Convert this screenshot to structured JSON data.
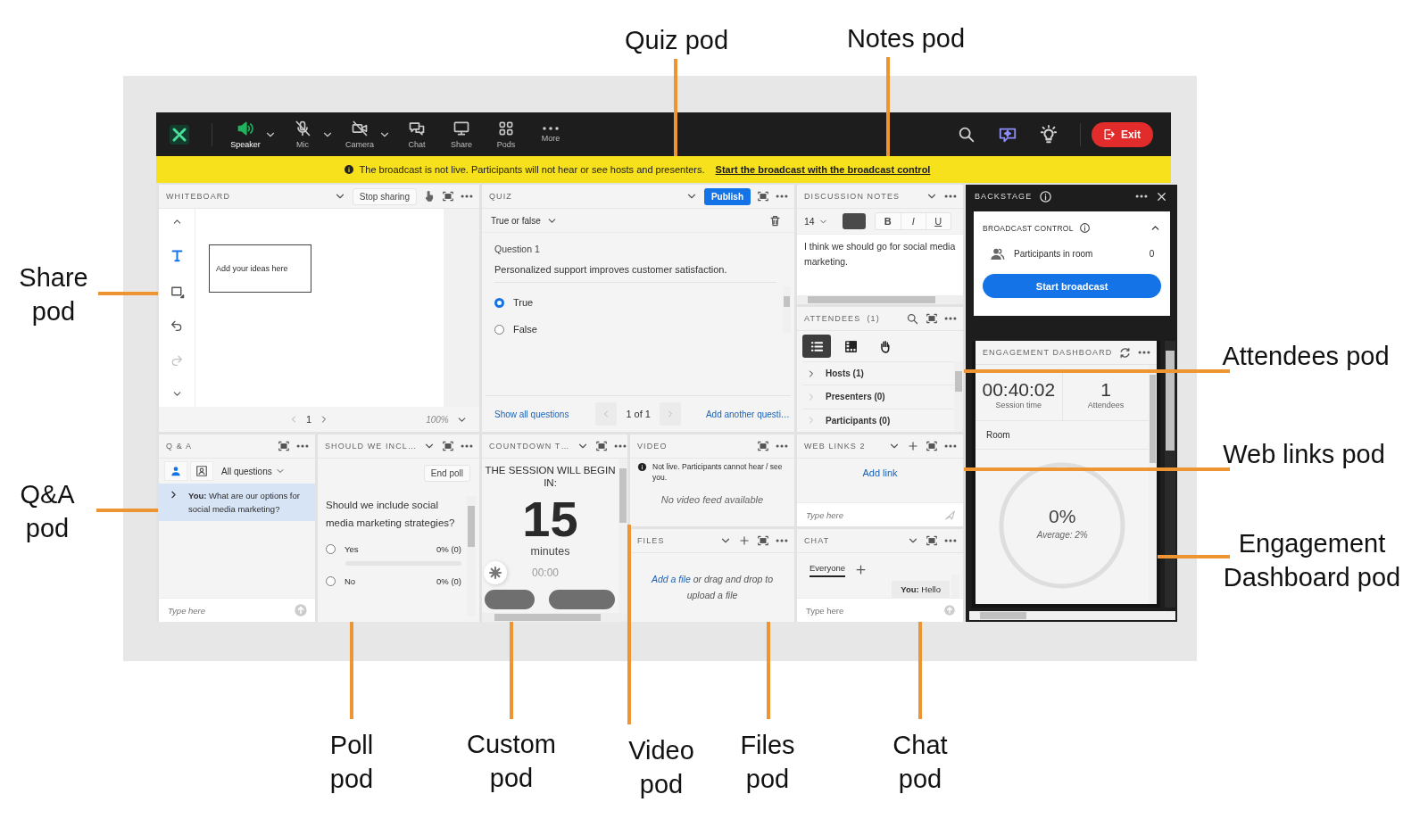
{
  "toolbar": {
    "tools": [
      {
        "kind": "speaker",
        "label": "Speaker",
        "muted": false,
        "dropdown": true
      },
      {
        "kind": "mic",
        "label": "Mic",
        "muted": true,
        "dropdown": true
      },
      {
        "kind": "camera",
        "label": "Camera",
        "muted": true,
        "dropdown": true
      },
      {
        "kind": "chat",
        "label": "Chat"
      },
      {
        "kind": "share",
        "label": "Share"
      },
      {
        "kind": "pods",
        "label": "Pods"
      },
      {
        "kind": "more",
        "label": "More"
      }
    ],
    "exit": "Exit"
  },
  "banner": {
    "message": "The broadcast is not live. Participants will not hear or see hosts and presenters.",
    "link": "Start the broadcast with the broadcast control"
  },
  "whiteboard": {
    "title": "WHITEBOARD",
    "stop_sharing": "Stop sharing",
    "note": "Add your ideas here",
    "page": "1",
    "zoom": "100%"
  },
  "quiz": {
    "title": "QUIZ",
    "publish": "Publish",
    "type": "True or false",
    "question_number": "Question 1",
    "question": "Personalized support improves customer satisfaction.",
    "options": [
      {
        "label": "True",
        "selected": true
      },
      {
        "label": "False",
        "selected": false
      }
    ],
    "show_all": "Show all questions",
    "pager": "1 of 1",
    "add_another": "Add another questi…"
  },
  "notes": {
    "title": "DISCUSSION NOTES",
    "font_size": "14",
    "bold": "B",
    "italic": "I",
    "underline": "U",
    "text": "I think we should go for social media marketing."
  },
  "attendees": {
    "title": "ATTENDEES",
    "count": "(1)",
    "views": [
      {
        "kind": "list",
        "selected": true
      },
      {
        "kind": "grid",
        "selected": false
      },
      {
        "kind": "hand",
        "selected": false
      }
    ],
    "groups": [
      "Hosts (1)",
      "Presenters (0)",
      "Participants (0)"
    ]
  },
  "backstage": {
    "title": "BACKSTAGE",
    "broadcast_title": "BROADCAST CONTROL",
    "participants_label": "Participants in room",
    "participants_count": "0",
    "start": "Start broadcast"
  },
  "engagement": {
    "title": "ENGAGEMENT DASHBOARD",
    "session_time": "00:40:02",
    "session_label": "Session time",
    "attendees": "1",
    "attendees_label": "Attendees",
    "room": "Room",
    "percent": "0%",
    "average": "Average: 2%"
  },
  "qa": {
    "title": "Q & A",
    "filter": "All questions",
    "questions": [
      {
        "author": "You:",
        "text": "What are our options for social media marketing?",
        "selected": true
      }
    ],
    "placeholder": "Type here"
  },
  "poll": {
    "title": "SHOULD WE INCL…",
    "end": "End poll",
    "question": "Should we include social media marketing strategies?",
    "options": [
      {
        "label": "Yes",
        "result": "0% (0)",
        "selected": false,
        "bar": true
      },
      {
        "label": "No",
        "result": "0% (0)",
        "selected": false
      }
    ]
  },
  "countdown": {
    "title": "COUNTDOWN T…",
    "heading": "THE SESSION WILL BEGIN IN:",
    "number": "15",
    "unit": "minutes",
    "time": "00:00"
  },
  "video": {
    "title": "VIDEO",
    "notice": "Not live. Participants cannot hear / see you.",
    "empty": "No video feed available"
  },
  "files": {
    "title": "FILES",
    "link": "Add a file",
    "rest": "or drag and drop to upload a file"
  },
  "web_links": {
    "title": "WEB LINKS 2",
    "add": "Add link",
    "placeholder": "Type here"
  },
  "chat": {
    "title": "CHAT",
    "tabs": [
      {
        "label": "Everyone",
        "selected": true
      }
    ],
    "messages": [
      {
        "author": "You:",
        "text": "Hello"
      }
    ],
    "placeholder": "Type here"
  },
  "callouts": [
    "Quiz pod",
    "Notes pod",
    "Share pod",
    "Attendees pod",
    "Q&A pod",
    "Web links pod",
    "Engagement Dashboard pod",
    "Poll pod",
    "Custom pod",
    "Video pod",
    "Files pod",
    "Chat pod"
  ]
}
